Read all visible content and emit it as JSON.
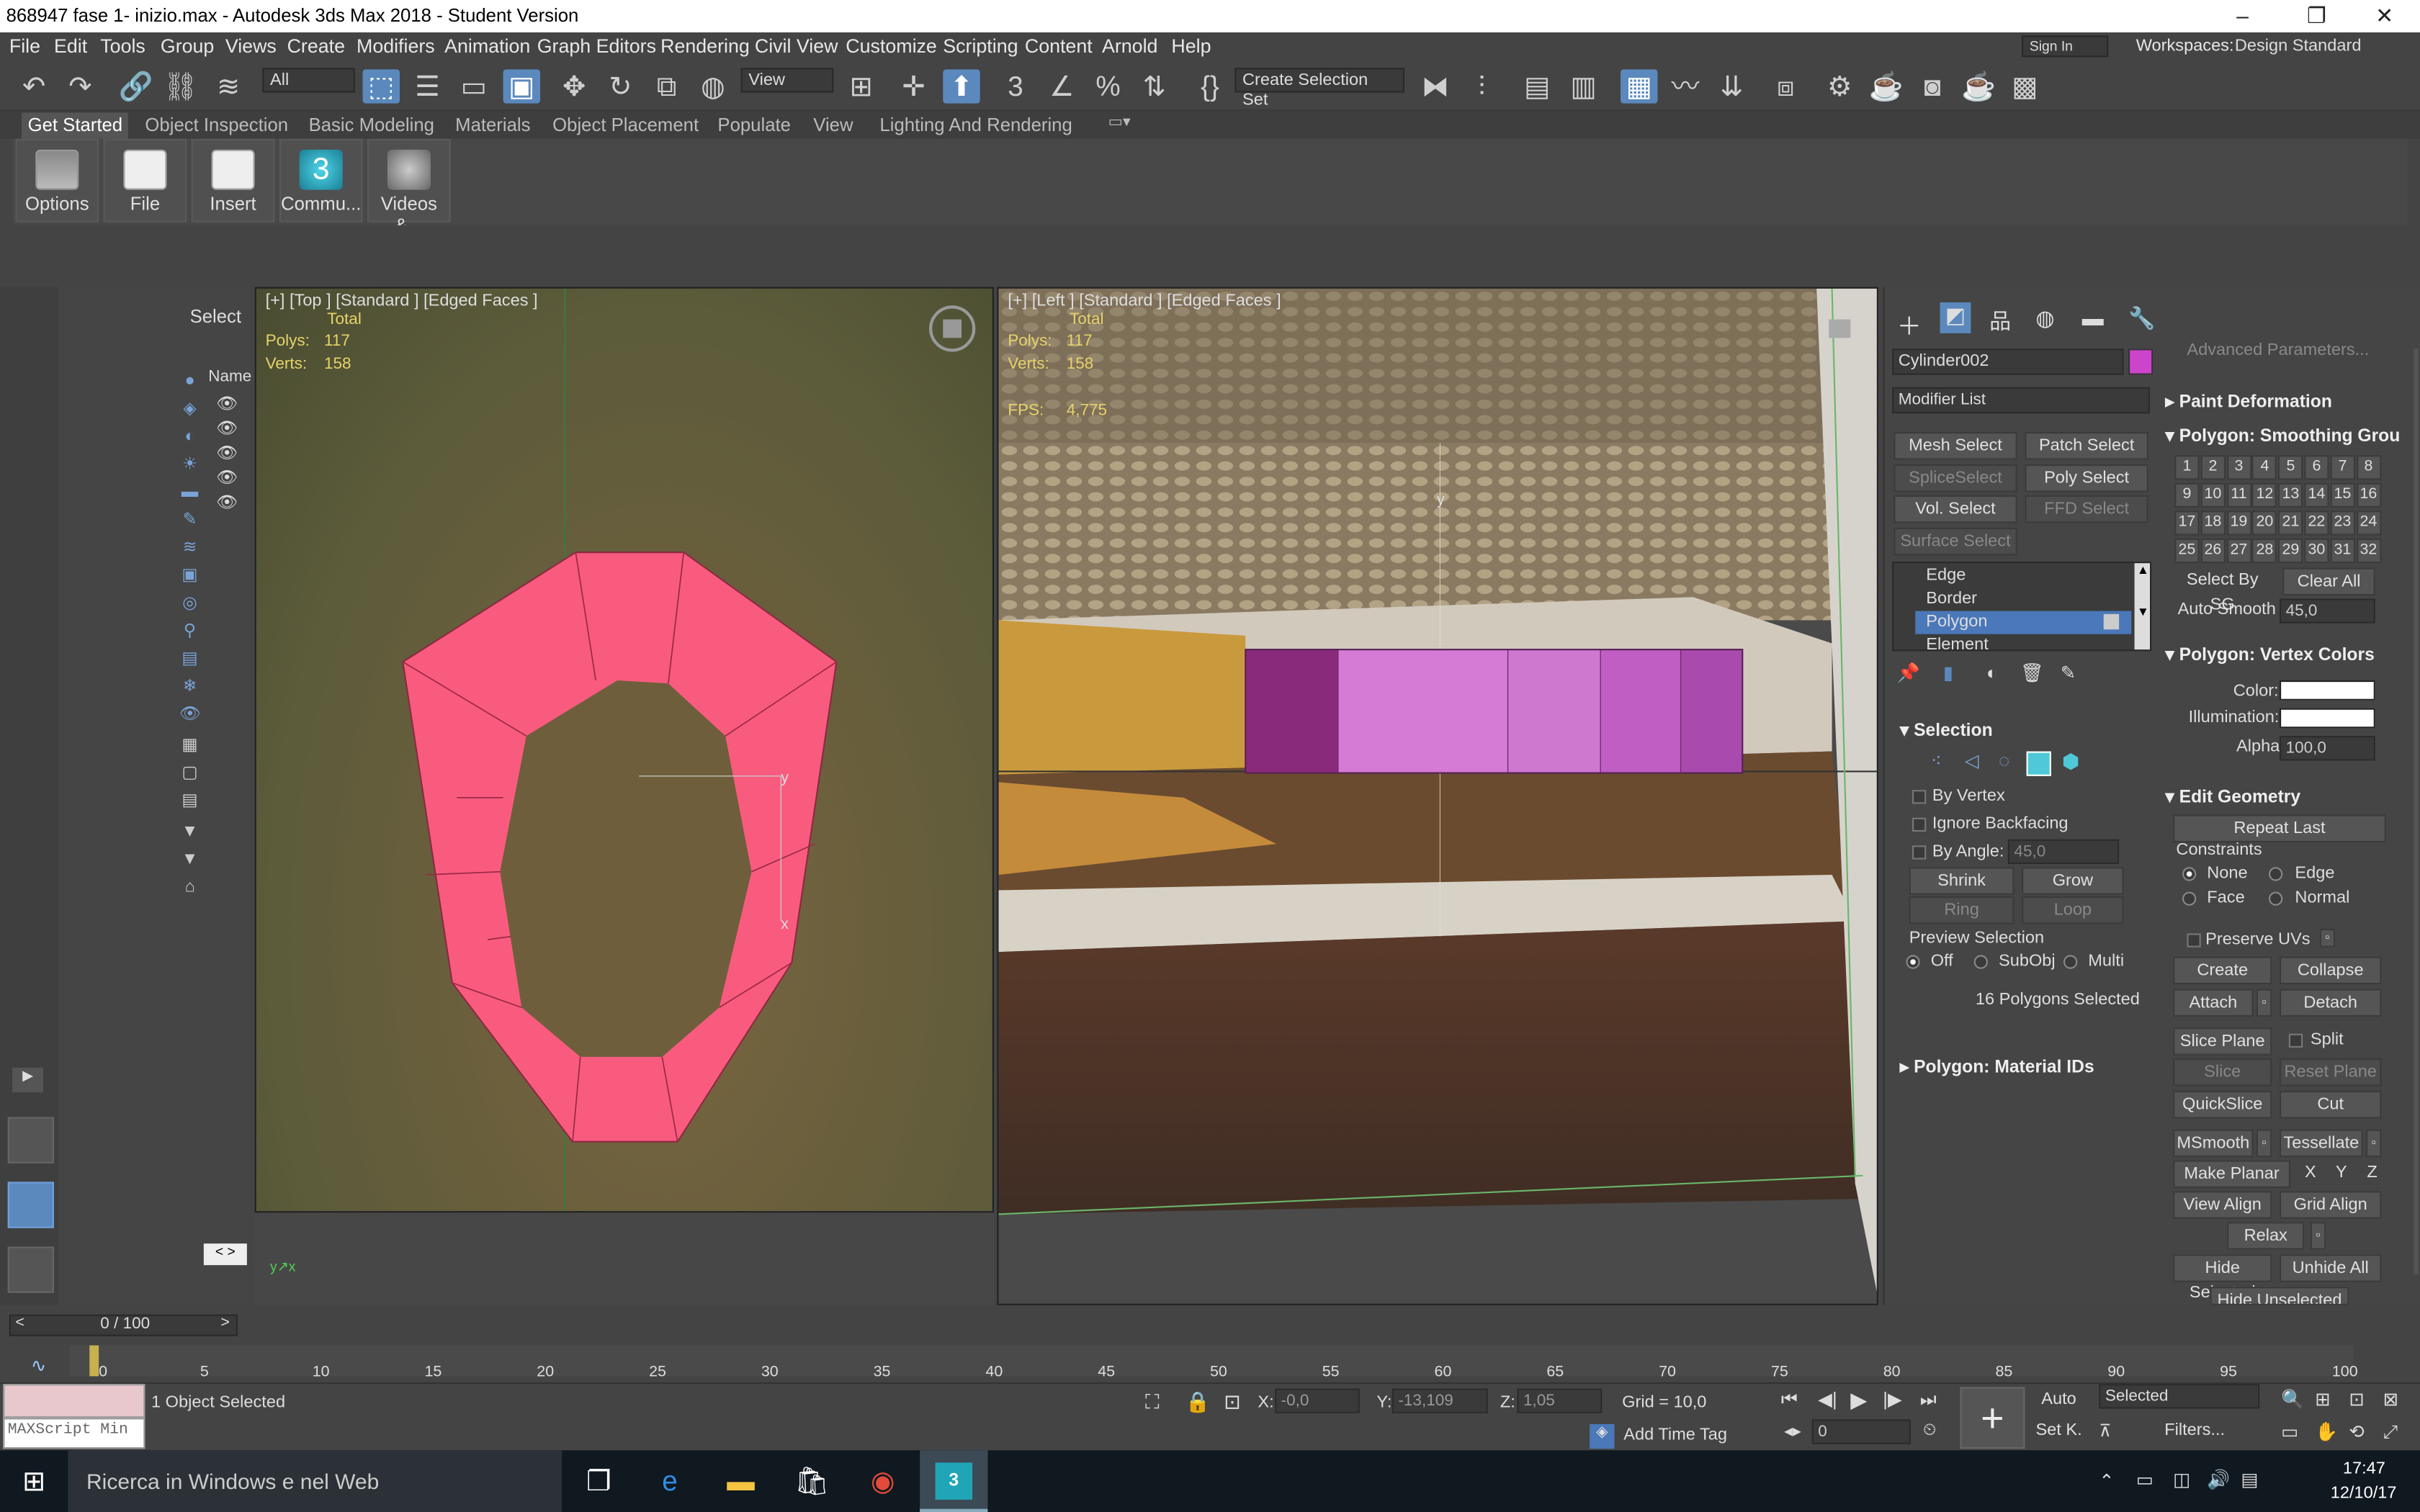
{
  "title": "868947 fase 1- inizio.max - Autodesk 3ds Max 2018 - Student Version",
  "window_controls": [
    "–",
    "❐",
    "✕"
  ],
  "menu": [
    "File",
    "Edit",
    "Tools",
    "Group",
    "Views",
    "Create",
    "Modifiers",
    "Animation",
    "Graph Editors",
    "Rendering",
    "Civil View",
    "Customize",
    "Scripting",
    "Content",
    "Arnold",
    "Help"
  ],
  "signin": "Sign In",
  "workspaces_label": "Workspaces:",
  "workspace_value": "Design Standard",
  "toolbar": {
    "filter": "All",
    "refcoord": "View",
    "selection_set": "Create Selection Set"
  },
  "ribbon_tabs": [
    "Get Started",
    "Object Inspection",
    "Basic Modeling",
    "Materials",
    "Object Placement",
    "Populate",
    "View",
    "Lighting And Rendering"
  ],
  "ribbon_buttons": [
    "Options",
    "File",
    "Insert",
    "Commu...",
    "Videos &..."
  ],
  "explorer": {
    "select_label": "Select",
    "name_header": "Name"
  },
  "viewport_top": {
    "label": "[+] [Top ] [Standard ] [Edged Faces ]",
    "stats_total": "Total",
    "polys_label": "Polys:",
    "polys": "117",
    "verts_label": "Verts:",
    "verts": "158"
  },
  "viewport_left": {
    "label": "[+] [Left ] [Standard ] [Edged Faces ]",
    "stats_total": "Total",
    "polys_label": "Polys:",
    "polys": "117",
    "verts_label": "Verts:",
    "verts": "158",
    "fps_label": "FPS:",
    "fps": "4,775"
  },
  "cmd": {
    "object_name": "Cylinder002",
    "object_color": "#cc44cc",
    "modifier_list": "Modifier List",
    "modifier_buttons": [
      "Mesh Select",
      "Patch Select",
      "SpliceSelect",
      "Poly Select",
      "Vol. Select",
      "FFD Select",
      "Surface Select"
    ],
    "stack": [
      "Edge",
      "Border",
      "Polygon",
      "Element"
    ],
    "selection_title": "Selection",
    "by_vertex": "By Vertex",
    "ignore_backfacing": "Ignore Backfacing",
    "by_angle": "By Angle:",
    "by_angle_val": "45,0",
    "shrink": "Shrink",
    "grow": "Grow",
    "ring": "Ring",
    "loop": "Loop",
    "preview_selection": "Preview Selection",
    "off": "Off",
    "subobj": "SubObj",
    "multi": "Multi",
    "selected_count": "16 Polygons Selected",
    "material_ids": "Polygon: Material IDs",
    "advanced": "Advanced Parameters...",
    "paint_deformation": "Paint Deformation",
    "smoothing_title": "Polygon: Smoothing Grou",
    "sg": [
      "1",
      "2",
      "3",
      "4",
      "5",
      "6",
      "7",
      "8",
      "9",
      "10",
      "11",
      "12",
      "13",
      "14",
      "15",
      "16",
      "17",
      "18",
      "19",
      "20",
      "21",
      "22",
      "23",
      "24",
      "25",
      "26",
      "27",
      "28",
      "29",
      "30",
      "31",
      "32"
    ],
    "select_by_sg": "Select By SG",
    "clear_all": "Clear All",
    "auto_smooth": "Auto Smooth",
    "auto_smooth_val": "45,0",
    "vertex_colors_title": "Polygon: Vertex Colors",
    "color": "Color:",
    "illumination": "Illumination:",
    "alpha": "Alpha:",
    "alpha_val": "100,0",
    "edit_geometry": "Edit Geometry",
    "repeat_last": "Repeat Last",
    "constraints": "Constraints",
    "none": "None",
    "edge": "Edge",
    "face": "Face",
    "normal": "Normal",
    "preserve_uvs": "Preserve UVs",
    "create": "Create",
    "collapse": "Collapse",
    "attach": "Attach",
    "detach": "Detach",
    "slice_plane": "Slice Plane",
    "split": "Split",
    "slice": "Slice",
    "reset_plane": "Reset Plane",
    "quickslice": "QuickSlice",
    "cut": "Cut",
    "msmooth": "MSmooth",
    "tessellate": "Tessellate",
    "make_planar": "Make Planar",
    "x": "X",
    "y": "Y",
    "z": "Z",
    "view_align": "View Align",
    "grid_align": "Grid Align",
    "relax": "Relax",
    "hide_selected": "Hide Selected",
    "unhide_all": "Unhide All",
    "hide_unselected": "Hide Unselected"
  },
  "timeline": {
    "frame": "0 / 100",
    "ticks": [
      "0",
      "5",
      "10",
      "15",
      "20",
      "25",
      "30",
      "35",
      "40",
      "45",
      "50",
      "55",
      "60",
      "65",
      "70",
      "75",
      "80",
      "85",
      "90",
      "95",
      "100"
    ]
  },
  "status": {
    "maxscript": "MAXScript Min",
    "objects_selected": "1 Object Selected",
    "x_label": "X:",
    "x": "-0,0",
    "y_label": "Y:",
    "y": "-13,109",
    "z_label": "Z:",
    "z": "1,05",
    "grid": "Grid = 10,0",
    "add_time_tag": "Add Time Tag",
    "auto": "Auto",
    "set_k": "Set K.",
    "selected": "Selected",
    "filters": "Filters...",
    "frame_field": "0"
  },
  "taskbar": {
    "search": "Ricerca in Windows e nel Web",
    "time": "17:47",
    "date": "12/10/17"
  }
}
